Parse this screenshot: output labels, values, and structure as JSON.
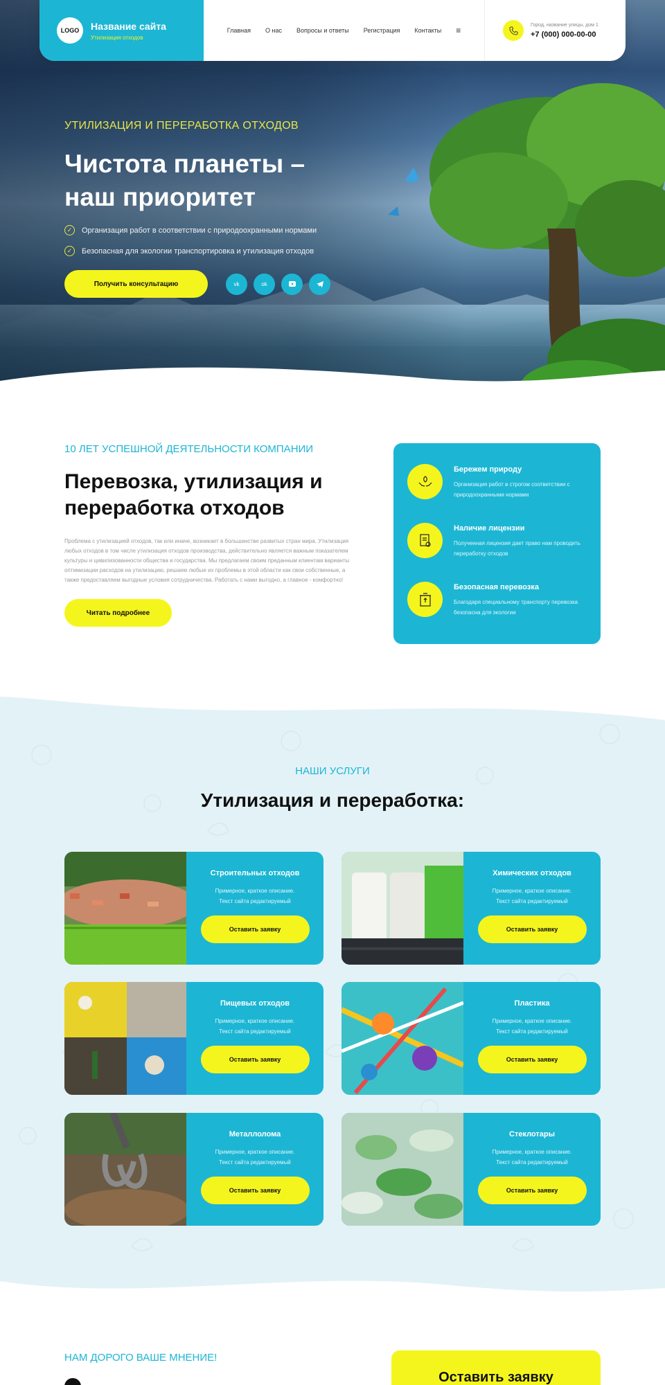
{
  "header": {
    "logo": "LOGO",
    "site_name": "Название сайта",
    "site_tagline": "Утилизация отходов",
    "nav": [
      "Главная",
      "О нас",
      "Вопросы и ответы",
      "Регистрация",
      "Контакты"
    ],
    "menu_icon": "≡",
    "address": "Город, название улицы, дом 1",
    "phone": "+7 (000) 000-00-00"
  },
  "hero": {
    "tag": "УТИЛИЗАЦИЯ И ПЕРЕРАБОТКА ОТХОДОВ",
    "title": "Чистота планеты – наш приоритет",
    "bullets": [
      "Организация работ в соответствии с природоохранными нормами",
      "Безопасная для экологии транспортировка и утилизация отходов"
    ],
    "cta": "Получить консультацию",
    "socials": [
      "vk",
      "ok",
      "yt",
      "tg"
    ]
  },
  "about": {
    "tag": "10 ЛЕТ УСПЕШНОЙ ДЕЯТЕЛЬНОСТИ КОМПАНИИ",
    "title": "Перевозка, утилизация и переработка отходов",
    "text": "Проблема с утилизацией отходов, так или иначе, возникает в большинстве развитых стран мира. Утилизация любых отходов в том числе утилизация отходов производства, действительно является важным показателем культуры и цивилизованности общества и государства. Мы предлагаем своим преданным клиентам варианты оптимизации расходов на утилизацию, решаем любые их проблемы в этой области как свои собственные, а также предоставляем выгодные условия сотрудничества. Работать с нами выгодно, а главное - комфортно!",
    "button": "Читать подробнее"
  },
  "features": [
    {
      "icon": "hands-leaf-icon",
      "title": "Бережем природу",
      "text": "Организация работ в строгом соответствии с природоохранными нормами"
    },
    {
      "icon": "license-icon",
      "title": "Наличие лицензии",
      "text": "Полученная лицензия дает право нам проводить переработку отходов"
    },
    {
      "icon": "recycle-bin-icon",
      "title": "Безопасная перевозка",
      "text": "Благодаря специальному транспорту перевозка безопасна для экологии"
    }
  ],
  "services": {
    "tag": "НАШИ УСЛУГИ",
    "title": "Утилизация и переработка:",
    "items": [
      {
        "title": "Строительных отходов",
        "desc_line1": "Примерное, краткое описание.",
        "desc_line2": "Текст сайта редактируемый",
        "button": "Оставить заявку"
      },
      {
        "title": "Химических отходов",
        "desc_line1": "Примерное, краткое описание.",
        "desc_line2": "Текст сайта редактируемый",
        "button": "Оставить заявку"
      },
      {
        "title": "Пищевых отходов",
        "desc_line1": "Примерное, краткое описание.",
        "desc_line2": "Текст сайта редактируемый",
        "button": "Оставить заявку"
      },
      {
        "title": "Пластика",
        "desc_line1": "Примерное, краткое описание.",
        "desc_line2": "Текст сайта редактируемый",
        "button": "Оставить заявку"
      },
      {
        "title": "Металлолома",
        "desc_line1": "Примерное, краткое описание.",
        "desc_line2": "Текст сайта редактируемый",
        "button": "Оставить заявку"
      },
      {
        "title": "Стеклотары",
        "desc_line1": "Примерное, краткое описание.",
        "desc_line2": "Текст сайта редактируемый",
        "button": "Оставить заявку"
      }
    ]
  },
  "opinion": {
    "tag": "НАМ ДОРОГО ВАШЕ МНЕНИЕ!",
    "order_title": "Оставить заявку"
  },
  "colors": {
    "accent": "#1cb6d4",
    "highlight": "#f5f51e",
    "light_bg": "#e3f2f7"
  }
}
